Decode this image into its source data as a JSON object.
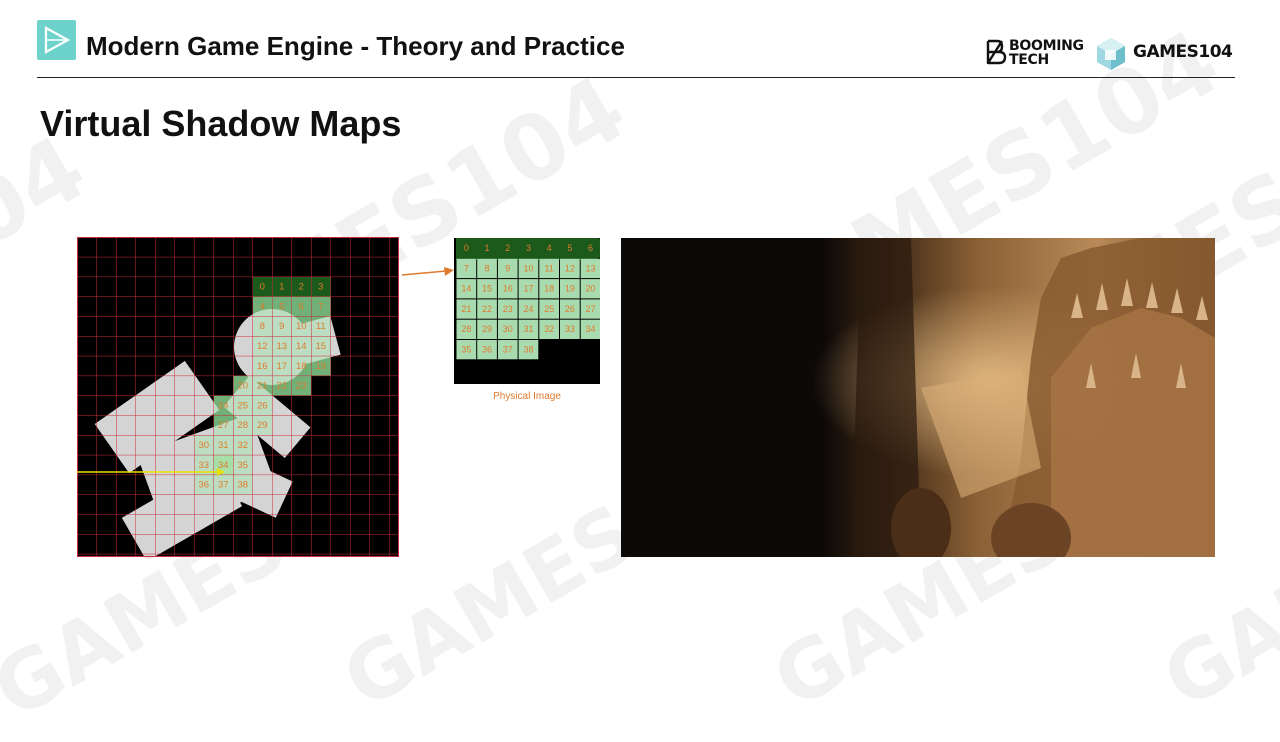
{
  "header": {
    "course_title": "Modern Game Engine - Theory and Practice",
    "logo_icon": "play-triangle-icon",
    "brand_booming_line1": "BOOMING",
    "brand_booming_line2": "TECH",
    "brand_games": "GAMES104",
    "accent_color": "#6ed2cc"
  },
  "page": {
    "title": "Virtual Shadow Maps"
  },
  "figure": {
    "virtual_map_tile_labels": [
      "0",
      "1",
      "2",
      "3",
      "4",
      "5",
      "6",
      "7",
      "8",
      "9",
      "10",
      "11",
      "12",
      "13",
      "14",
      "15",
      "16",
      "17",
      "18",
      "19",
      "20",
      "21",
      "22",
      "23",
      "24",
      "25",
      "26",
      "27",
      "28",
      "29",
      "30",
      "31",
      "32",
      "33",
      "34",
      "35",
      "36",
      "37",
      "38"
    ],
    "physical_image_caption": "Physical Image",
    "physical_tile_labels": [
      "0",
      "1",
      "2",
      "3",
      "4",
      "5",
      "6",
      "7",
      "8",
      "9",
      "10",
      "11",
      "12",
      "13",
      "14",
      "15",
      "16",
      "17",
      "18",
      "19",
      "20",
      "21",
      "22",
      "23",
      "24",
      "25",
      "26",
      "27",
      "28",
      "29",
      "30",
      "31",
      "32",
      "33",
      "34",
      "35",
      "36",
      "37",
      "38"
    ],
    "grid_color": "#cc2a3a",
    "tile_color": "#a8dcb0",
    "label_color": "#e07a2c"
  },
  "render": {
    "description_icon": "game-scene-render-image"
  }
}
